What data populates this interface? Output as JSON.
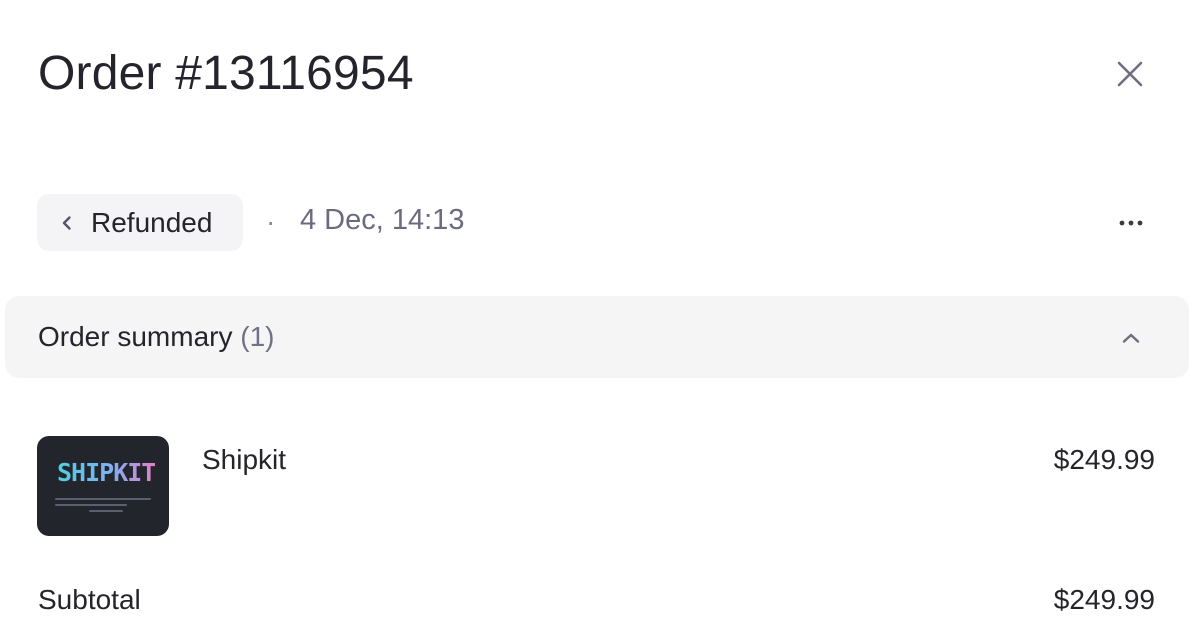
{
  "header": {
    "title": "Order #13116954",
    "close_icon": "close-icon"
  },
  "status": {
    "label": "Refunded",
    "icon": "chevron-left-icon",
    "separator": "·",
    "date": "4 Dec, 14:13",
    "more_icon": "more-horizontal-icon"
  },
  "summary": {
    "label": "Order summary",
    "count": "(1)",
    "toggle_icon": "chevron-up-icon"
  },
  "items": [
    {
      "thumbnail_text": "SHIPKIT",
      "name": "Shipkit",
      "price": "$249.99"
    }
  ],
  "totals": {
    "subtotal_label": "Subtotal",
    "subtotal_value": "$249.99"
  },
  "colors": {
    "pill_bg": "#f4f4f6",
    "summary_bg": "#f5f5f6",
    "muted_text": "#6b6b80",
    "thumb_bg": "#22252c"
  }
}
